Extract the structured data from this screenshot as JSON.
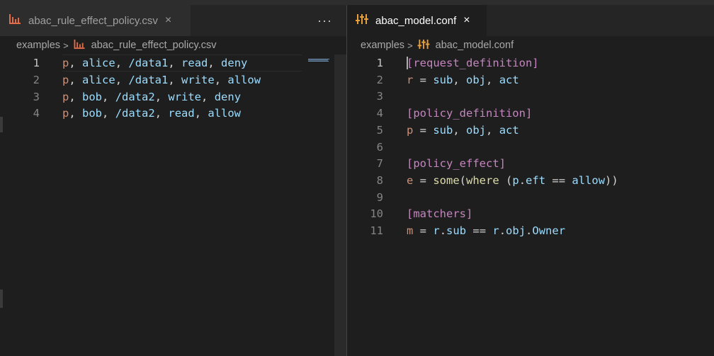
{
  "colors": {
    "csv_icon": "#e06c4a",
    "conf_icon": "#e8a03a"
  },
  "left": {
    "tab": {
      "label": "abac_rule_effect_policy.csv",
      "icon": "chart-file-icon",
      "close": "×"
    },
    "more": "···",
    "breadcrumb": {
      "folder": "examples",
      "file": "abac_rule_effect_policy.csv"
    },
    "lines": [
      {
        "num": "1",
        "tokens": [
          [
            "p",
            "kw"
          ],
          [
            ", ",
            "punc"
          ],
          [
            "alice",
            "txt"
          ],
          [
            ", ",
            "punc"
          ],
          [
            "/data1",
            "txt"
          ],
          [
            ", ",
            "punc"
          ],
          [
            "read",
            "txt"
          ],
          [
            ", ",
            "punc"
          ],
          [
            "deny",
            "txt"
          ]
        ]
      },
      {
        "num": "2",
        "tokens": [
          [
            "p",
            "kw"
          ],
          [
            ", ",
            "punc"
          ],
          [
            "alice",
            "txt"
          ],
          [
            ", ",
            "punc"
          ],
          [
            "/data1",
            "txt"
          ],
          [
            ", ",
            "punc"
          ],
          [
            "write",
            "txt"
          ],
          [
            ", ",
            "punc"
          ],
          [
            "allow",
            "txt"
          ]
        ]
      },
      {
        "num": "3",
        "tokens": [
          [
            "p",
            "kw"
          ],
          [
            ", ",
            "punc"
          ],
          [
            "bob",
            "txt"
          ],
          [
            ", ",
            "punc"
          ],
          [
            "/data2",
            "txt"
          ],
          [
            ", ",
            "punc"
          ],
          [
            "write",
            "txt"
          ],
          [
            ", ",
            "punc"
          ],
          [
            "deny",
            "txt"
          ]
        ]
      },
      {
        "num": "4",
        "tokens": [
          [
            "p",
            "kw"
          ],
          [
            ", ",
            "punc"
          ],
          [
            "bob",
            "txt"
          ],
          [
            ", ",
            "punc"
          ],
          [
            "/data2",
            "txt"
          ],
          [
            ", ",
            "punc"
          ],
          [
            "read",
            "txt"
          ],
          [
            ", ",
            "punc"
          ],
          [
            "allow",
            "txt"
          ]
        ]
      }
    ]
  },
  "right": {
    "tab": {
      "label": "abac_model.conf",
      "icon": "settings-file-icon",
      "close": "×"
    },
    "breadcrumb": {
      "folder": "examples",
      "file": "abac_model.conf"
    },
    "lines": [
      {
        "num": "1",
        "tokens": [
          [
            "[request_definition]",
            "sect"
          ]
        ]
      },
      {
        "num": "2",
        "tokens": [
          [
            "r",
            "kw"
          ],
          [
            " = ",
            "punc"
          ],
          [
            "sub",
            "txt"
          ],
          [
            ", ",
            "punc"
          ],
          [
            "obj",
            "txt"
          ],
          [
            ", ",
            "punc"
          ],
          [
            "act",
            "txt"
          ]
        ]
      },
      {
        "num": "3",
        "tokens": []
      },
      {
        "num": "4",
        "tokens": [
          [
            "[policy_definition]",
            "sect"
          ]
        ]
      },
      {
        "num": "5",
        "tokens": [
          [
            "p",
            "kw"
          ],
          [
            " = ",
            "punc"
          ],
          [
            "sub",
            "txt"
          ],
          [
            ", ",
            "punc"
          ],
          [
            "obj",
            "txt"
          ],
          [
            ", ",
            "punc"
          ],
          [
            "act",
            "txt"
          ]
        ]
      },
      {
        "num": "6",
        "tokens": []
      },
      {
        "num": "7",
        "tokens": [
          [
            "[policy_effect]",
            "sect"
          ]
        ]
      },
      {
        "num": "8",
        "tokens": [
          [
            "e",
            "kw"
          ],
          [
            " = ",
            "punc"
          ],
          [
            "some",
            "fn"
          ],
          [
            "(",
            "punc"
          ],
          [
            "where",
            "fn"
          ],
          [
            " (",
            "punc"
          ],
          [
            "p",
            "txt"
          ],
          [
            ".",
            "punc"
          ],
          [
            "eft",
            "txt"
          ],
          [
            " == ",
            "punc"
          ],
          [
            "allow",
            "txt"
          ],
          [
            "))",
            "punc"
          ]
        ]
      },
      {
        "num": "9",
        "tokens": []
      },
      {
        "num": "10",
        "tokens": [
          [
            "[matchers]",
            "sect"
          ]
        ]
      },
      {
        "num": "11",
        "tokens": [
          [
            "m",
            "kw"
          ],
          [
            " = ",
            "punc"
          ],
          [
            "r",
            "txt"
          ],
          [
            ".",
            "punc"
          ],
          [
            "sub",
            "txt"
          ],
          [
            " == ",
            "punc"
          ],
          [
            "r",
            "txt"
          ],
          [
            ".",
            "punc"
          ],
          [
            "obj",
            "txt"
          ],
          [
            ".",
            "punc"
          ],
          [
            "Owner",
            "txt"
          ]
        ]
      }
    ]
  }
}
